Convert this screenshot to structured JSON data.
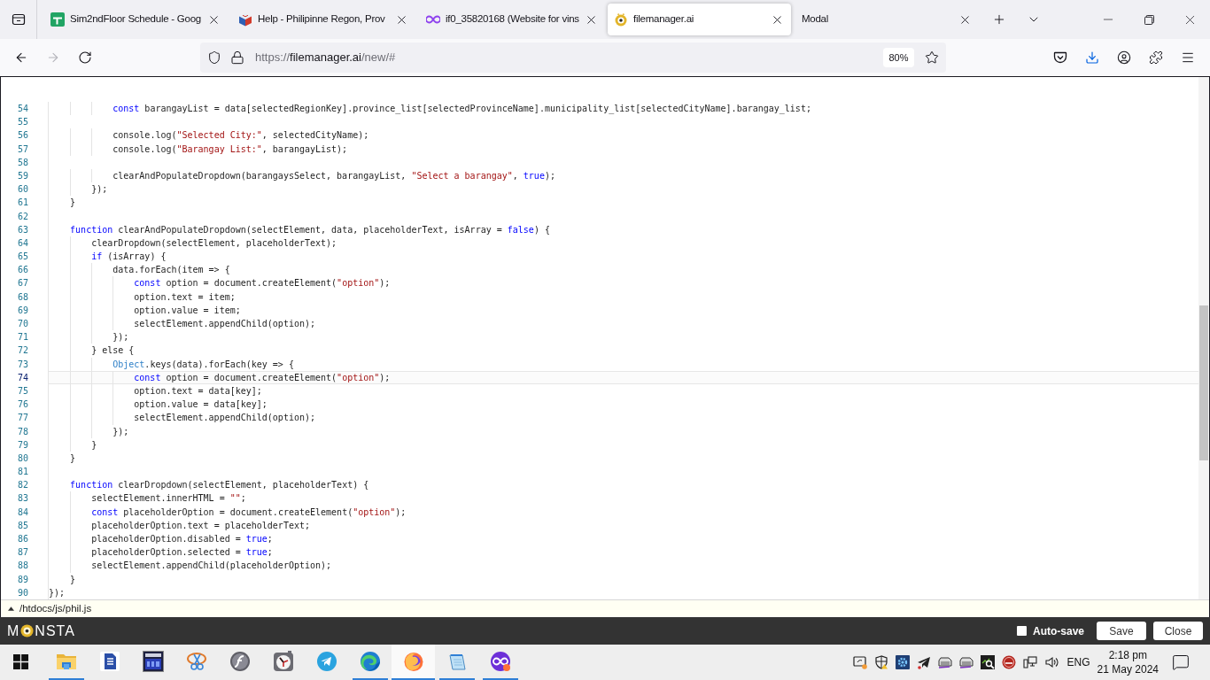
{
  "browser": {
    "tabs": [
      {
        "title": "Sim2ndFloor Schedule - Goog",
        "selected": false
      },
      {
        "title": "Help - Philipinne Regon, Prov",
        "selected": false
      },
      {
        "title": "if0_35820168 (Website for vins",
        "selected": false
      },
      {
        "title": "filemanager.ai",
        "selected": true
      },
      {
        "title": "Modal",
        "selected": false
      }
    ],
    "address_bar": {
      "scheme": "https://",
      "host": "filemanager.ai",
      "path": "/new/#",
      "zoom": "80%"
    }
  },
  "editor": {
    "lines": [
      {
        "number": "54",
        "active": false,
        "tokens": [
          {
            "kind": "keyword",
            "text": "            const"
          },
          {
            "kind": "plain",
            "text": " barangayList = data[selectedRegionKey].province_list[selectedProvinceName].municipality_list[selectedCityName].barangay_list;"
          }
        ]
      },
      {
        "number": "55",
        "active": false
      },
      {
        "number": "56",
        "active": false,
        "tokens": [
          {
            "kind": "plain",
            "text": "            console.log("
          },
          {
            "kind": "string",
            "text": "\"Selected City:\""
          },
          {
            "kind": "plain",
            "text": ", selectedCityName);"
          }
        ]
      },
      {
        "number": "57",
        "active": false,
        "tokens": [
          {
            "kind": "plain",
            "text": "            console.log("
          },
          {
            "kind": "string",
            "text": "\"Barangay List:\""
          },
          {
            "kind": "plain",
            "text": ", barangayList);"
          }
        ]
      },
      {
        "number": "58",
        "active": false
      },
      {
        "number": "59",
        "active": false,
        "tokens": [
          {
            "kind": "plain",
            "text": "            clearAndPopulateDropdown(barangaysSelect, barangayList, "
          },
          {
            "kind": "string",
            "text": "\"Select a barangay\""
          },
          {
            "kind": "plain",
            "text": ", "
          },
          {
            "kind": "keyword",
            "text": "true"
          },
          {
            "kind": "plain",
            "text": ");"
          }
        ]
      },
      {
        "number": "60",
        "active": false,
        "tokens": [
          {
            "kind": "plain",
            "text": "        });"
          }
        ]
      },
      {
        "number": "61",
        "active": false,
        "tokens": [
          {
            "kind": "plain",
            "text": "    }"
          }
        ]
      },
      {
        "number": "62",
        "active": false
      },
      {
        "number": "63",
        "active": false,
        "tokens": [
          {
            "kind": "keyword",
            "text": "    function"
          },
          {
            "kind": "plain",
            "text": " clearAndPopulateDropdown(selectElement, data, placeholderText, isArray = "
          },
          {
            "kind": "keyword",
            "text": "false"
          },
          {
            "kind": "plain",
            "text": ") {"
          }
        ]
      },
      {
        "number": "64",
        "active": false,
        "tokens": [
          {
            "kind": "plain",
            "text": "        clearDropdown(selectElement, placeholderText);"
          }
        ]
      },
      {
        "number": "65",
        "active": false,
        "tokens": [
          {
            "kind": "keyword",
            "text": "        if"
          },
          {
            "kind": "plain",
            "text": " (isArray) {"
          }
        ]
      },
      {
        "number": "66",
        "active": false,
        "tokens": [
          {
            "kind": "plain",
            "text": "            data.forEach(item => {"
          }
        ]
      },
      {
        "number": "67",
        "active": false,
        "tokens": [
          {
            "kind": "keyword",
            "text": "                const"
          },
          {
            "kind": "plain",
            "text": " option = document.createElement("
          },
          {
            "kind": "string",
            "text": "\"option\""
          },
          {
            "kind": "plain",
            "text": ");"
          }
        ]
      },
      {
        "number": "68",
        "active": false,
        "tokens": [
          {
            "kind": "plain",
            "text": "                option.text = item;"
          }
        ]
      },
      {
        "number": "69",
        "active": false,
        "tokens": [
          {
            "kind": "plain",
            "text": "                option.value = item;"
          }
        ]
      },
      {
        "number": "70",
        "active": false,
        "tokens": [
          {
            "kind": "plain",
            "text": "                selectElement.appendChild(option);"
          }
        ]
      },
      {
        "number": "71",
        "active": false,
        "tokens": [
          {
            "kind": "plain",
            "text": "            });"
          }
        ]
      },
      {
        "number": "72",
        "active": false,
        "tokens": [
          {
            "kind": "plain",
            "text": "        } else {"
          }
        ]
      },
      {
        "number": "73",
        "active": false,
        "tokens": [
          {
            "kind": "type",
            "text": "            Object"
          },
          {
            "kind": "plain",
            "text": ".keys(data).forEach(key => {"
          }
        ]
      },
      {
        "number": "74",
        "active": true,
        "tokens": [
          {
            "kind": "keyword",
            "text": "                const"
          },
          {
            "kind": "plain",
            "text": " option = document.createElement("
          },
          {
            "kind": "string",
            "text": "\"option\""
          },
          {
            "kind": "plain",
            "text": ");"
          }
        ]
      },
      {
        "number": "75",
        "active": false,
        "tokens": [
          {
            "kind": "plain",
            "text": "                option.text = data[key];"
          }
        ]
      },
      {
        "number": "76",
        "active": false,
        "tokens": [
          {
            "kind": "plain",
            "text": "                option.value = data[key];"
          }
        ]
      },
      {
        "number": "77",
        "active": false,
        "tokens": [
          {
            "kind": "plain",
            "text": "                selectElement.appendChild(option);"
          }
        ]
      },
      {
        "number": "78",
        "active": false,
        "tokens": [
          {
            "kind": "plain",
            "text": "            });"
          }
        ]
      },
      {
        "number": "79",
        "active": false,
        "tokens": [
          {
            "kind": "plain",
            "text": "        }"
          }
        ]
      },
      {
        "number": "80",
        "active": false,
        "tokens": [
          {
            "kind": "plain",
            "text": "    }"
          }
        ]
      },
      {
        "number": "81",
        "active": false
      },
      {
        "number": "82",
        "active": false,
        "tokens": [
          {
            "kind": "keyword",
            "text": "    function"
          },
          {
            "kind": "plain",
            "text": " clearDropdown(selectElement, placeholderText) {"
          }
        ]
      },
      {
        "number": "83",
        "active": false,
        "tokens": [
          {
            "kind": "plain",
            "text": "        selectElement.innerHTML = "
          },
          {
            "kind": "string",
            "text": "\"\""
          },
          {
            "kind": "plain",
            "text": ";"
          }
        ]
      },
      {
        "number": "84",
        "active": false,
        "tokens": [
          {
            "kind": "keyword",
            "text": "        const"
          },
          {
            "kind": "plain",
            "text": " placeholderOption = document.createElement("
          },
          {
            "kind": "string",
            "text": "\"option\""
          },
          {
            "kind": "plain",
            "text": ");"
          }
        ]
      },
      {
        "number": "85",
        "active": false,
        "tokens": [
          {
            "kind": "plain",
            "text": "        placeholderOption.text = placeholderText;"
          }
        ]
      },
      {
        "number": "86",
        "active": false,
        "tokens": [
          {
            "kind": "plain",
            "text": "        placeholderOption.disabled = "
          },
          {
            "kind": "keyword",
            "text": "true"
          },
          {
            "kind": "plain",
            "text": ";"
          }
        ]
      },
      {
        "number": "87",
        "active": false,
        "tokens": [
          {
            "kind": "plain",
            "text": "        placeholderOption.selected = "
          },
          {
            "kind": "keyword",
            "text": "true"
          },
          {
            "kind": "plain",
            "text": ";"
          }
        ]
      },
      {
        "number": "88",
        "active": false,
        "tokens": [
          {
            "kind": "plain",
            "text": "        selectElement.appendChild(placeholderOption);"
          }
        ]
      },
      {
        "number": "89",
        "active": false,
        "tokens": [
          {
            "kind": "plain",
            "text": "    }"
          }
        ]
      },
      {
        "number": "90",
        "active": false,
        "tokens": [
          {
            "kind": "plain",
            "text": "});"
          }
        ]
      }
    ],
    "file_path": "/htdocs/js/phil.js"
  },
  "footer": {
    "logo": [
      "M",
      "NSTA"
    ],
    "auto_save": {
      "label": "Auto-save",
      "checked": false
    },
    "buttons": [
      "Save",
      "Close"
    ]
  },
  "taskbar": {
    "apps": [
      {
        "running": false,
        "selected": false
      },
      {
        "running": true,
        "selected": false
      },
      {
        "running": false,
        "selected": false
      },
      {
        "running": false,
        "selected": false
      },
      {
        "running": false,
        "selected": false
      },
      {
        "running": false,
        "selected": false
      },
      {
        "running": false,
        "selected": false
      },
      {
        "running": false,
        "selected": false
      },
      {
        "running": true,
        "selected": false
      },
      {
        "running": true,
        "selected": true
      },
      {
        "running": true,
        "selected": false
      },
      {
        "running": true,
        "selected": false
      }
    ],
    "tray": {
      "language": "ENG",
      "time": "2:18 pm",
      "date": "21 May 2024"
    }
  }
}
